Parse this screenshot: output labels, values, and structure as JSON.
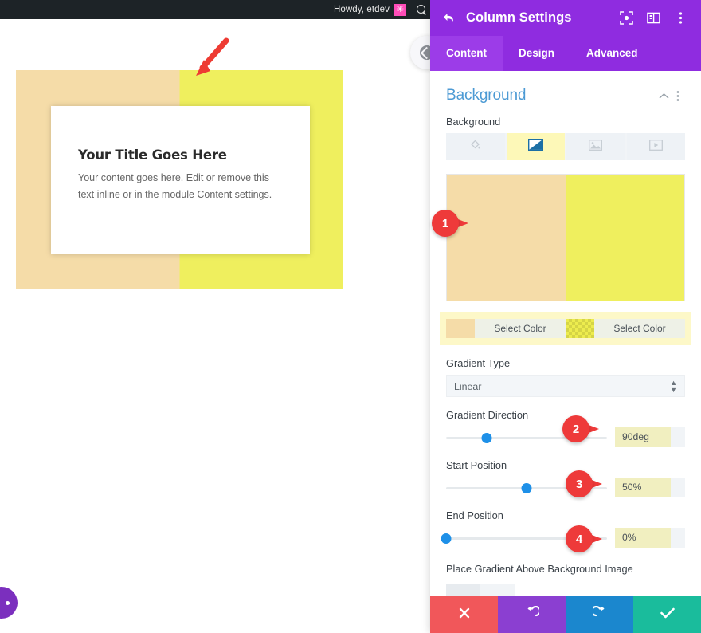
{
  "adminbar": {
    "howdy": "Howdy, etdev",
    "avatar_glyph": "✳",
    "search_icon": "search-icon"
  },
  "preview": {
    "module_title": "Your Title Goes Here",
    "module_text": "Your content goes here. Edit or remove this text inline or in the module Content settings.",
    "gradient_start_color": "#F5DCA8",
    "gradient_end_color": "#EFEF5E",
    "split_percent": "50%",
    "arrow_annotation": "red-arrow-down-left"
  },
  "panel": {
    "title": "Column Settings",
    "back_icon": "back-arrow-icon",
    "header_icons": [
      {
        "name": "focus-target-icon"
      },
      {
        "name": "panel-layout-icon"
      },
      {
        "name": "kebab-menu-icon"
      }
    ],
    "tabs": [
      {
        "label": "Content",
        "active": true
      },
      {
        "label": "Design",
        "active": false
      },
      {
        "label": "Advanced",
        "active": false
      }
    ],
    "accent_purple": "#8F2CE0",
    "accent_blue": "#4C9AD4",
    "section": {
      "title": "Background",
      "collapse_icon": "chevron-up-icon",
      "more_icon": "kebab-menu-icon"
    },
    "background": {
      "label": "Background",
      "types": [
        {
          "name": "background-color-tab",
          "icon": "paint-bucket-icon",
          "active": false
        },
        {
          "name": "background-gradient-tab",
          "icon": "gradient-icon",
          "active": true
        },
        {
          "name": "background-image-tab",
          "icon": "image-icon",
          "active": false
        },
        {
          "name": "background-video-tab",
          "icon": "video-icon",
          "active": false
        }
      ]
    },
    "colors": {
      "start_swatch": "#F5DCA8",
      "start_button": "Select Color",
      "end_swatch": "#EDEC4E",
      "end_button": "Select Color"
    },
    "gradient_type": {
      "label": "Gradient Type",
      "value": "Linear"
    },
    "gradient_direction": {
      "label": "Gradient Direction",
      "value": "90deg",
      "slider_percent": 25
    },
    "start_position": {
      "label": "Start Position",
      "value": "50%",
      "slider_percent": 50
    },
    "end_position": {
      "label": "End Position",
      "value": "0%",
      "slider_percent": 0
    },
    "place_gradient": {
      "label": "Place Gradient Above Background Image"
    },
    "footer": [
      {
        "name": "cancel-button",
        "icon": "close-x-icon",
        "color": "#F1575A"
      },
      {
        "name": "undo-button",
        "icon": "undo-arrow-icon",
        "color": "#8B3FD1"
      },
      {
        "name": "redo-button",
        "icon": "redo-arrow-icon",
        "color": "#1B87CE"
      },
      {
        "name": "save-button",
        "icon": "checkmark-icon",
        "color": "#1ABC9C"
      }
    ]
  },
  "annotations": [
    {
      "number": "1",
      "target": "gradient-preview"
    },
    {
      "number": "2",
      "target": "gradient-direction"
    },
    {
      "number": "3",
      "target": "start-position"
    },
    {
      "number": "4",
      "target": "end-position"
    }
  ]
}
